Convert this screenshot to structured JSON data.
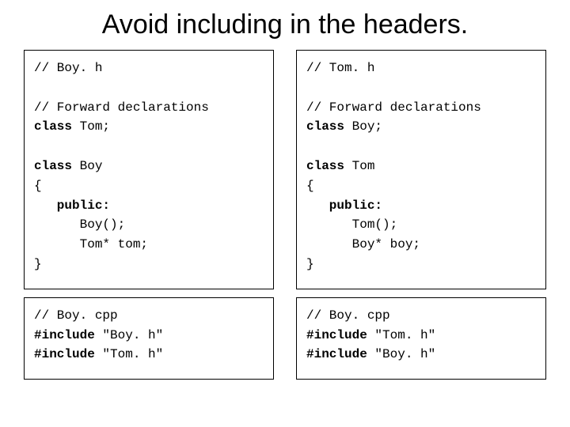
{
  "title": "Avoid including in the headers.",
  "boxes": {
    "boy_h": {
      "l1": "// Boy. h",
      "l2": "// Forward declarations",
      "l3a": "class",
      "l3b": " Tom;",
      "l4a": "class",
      "l4b": " Boy",
      "l5": "{",
      "l6a": "   public:",
      "l6b": "",
      "l7": "      Boy();",
      "l8": "      Tom* tom;",
      "l9": "}"
    },
    "tom_h": {
      "l1": "// Tom. h",
      "l2": "// Forward declarations",
      "l3a": "class",
      "l3b": " Boy;",
      "l4a": "class",
      "l4b": " Tom",
      "l5": "{",
      "l6a": "   public:",
      "l6b": "",
      "l7": "      Tom();",
      "l8": "      Boy* boy;",
      "l9": "}"
    },
    "boy_cpp": {
      "l1": "// Boy. cpp",
      "l2a": "#include",
      "l2b": " \"Boy. h\"",
      "l3a": "#include",
      "l3b": " \"Tom. h\""
    },
    "tom_cpp": {
      "l1": "// Boy. cpp",
      "l2a": "#include",
      "l2b": " \"Tom. h\"",
      "l3a": "#include",
      "l3b": " \"Boy. h\""
    }
  }
}
